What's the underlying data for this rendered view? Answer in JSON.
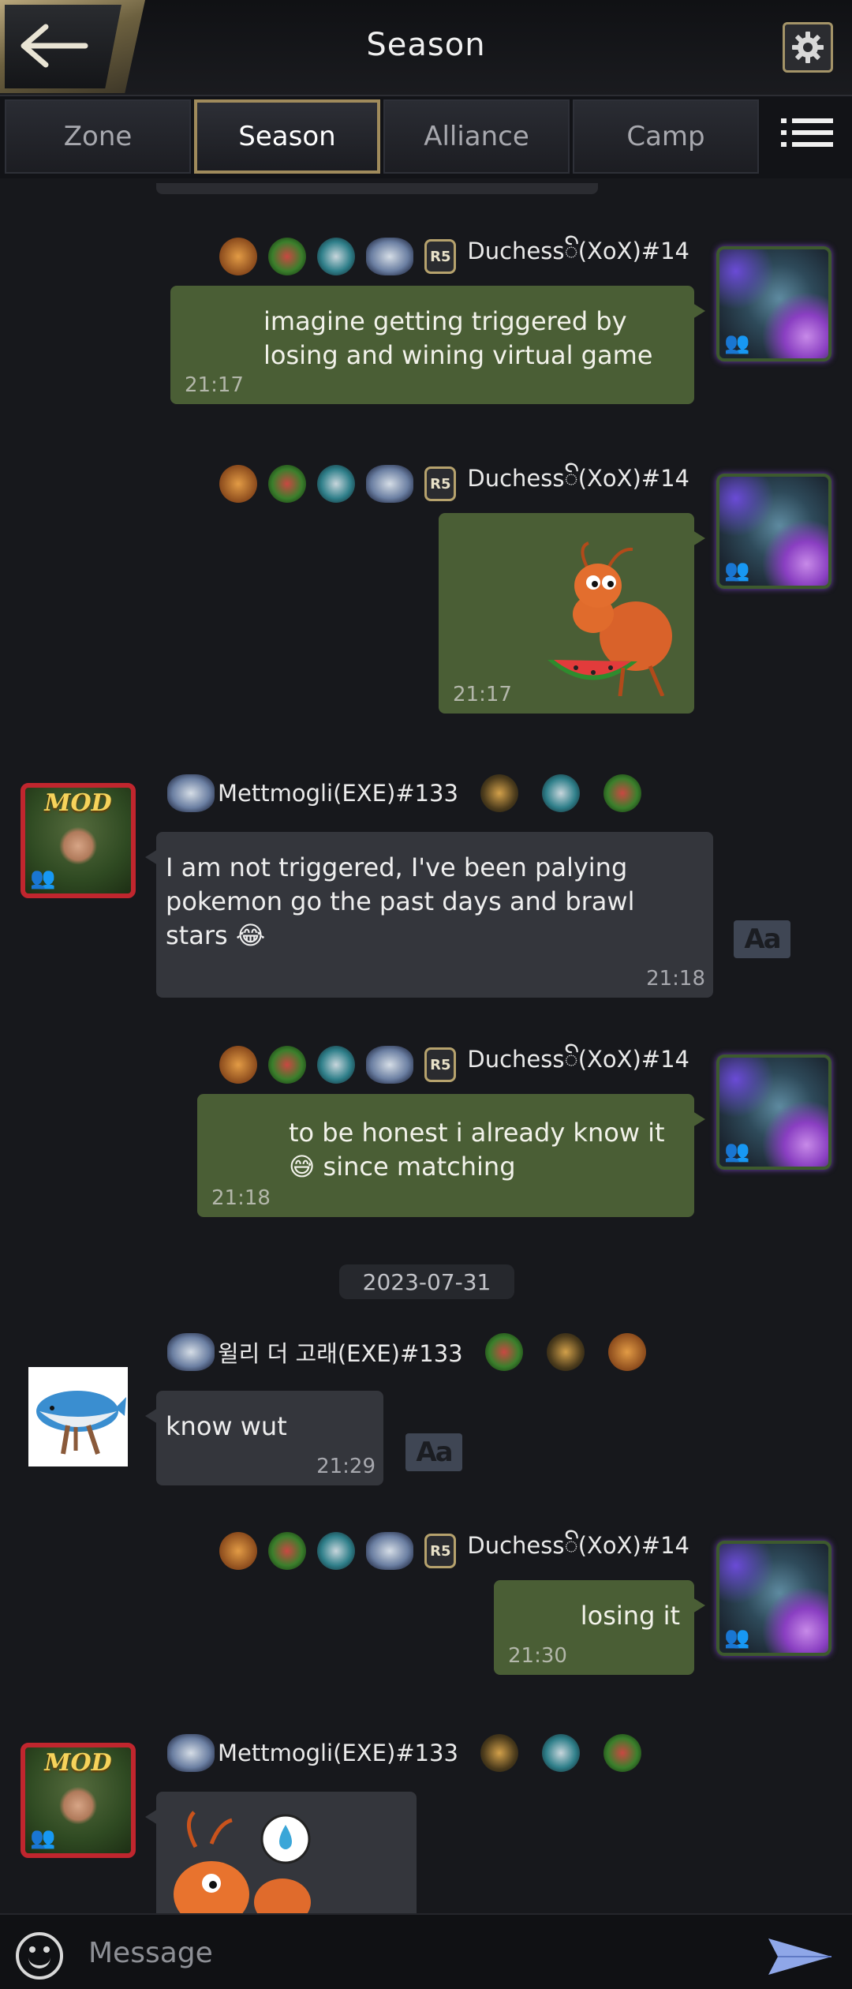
{
  "header": {
    "title": "Season"
  },
  "tabs": [
    {
      "label": "Zone",
      "active": false
    },
    {
      "label": "Season",
      "active": true
    },
    {
      "label": "Alliance",
      "active": false
    },
    {
      "label": "Camp",
      "active": false
    }
  ],
  "icons": {
    "back": "back-arrow-icon",
    "settings": "gear-icon",
    "menu": "list-menu-icon",
    "emoji": "smiley-icon",
    "send": "send-arrow-icon",
    "translate": "translate-icon"
  },
  "colors": {
    "own_bubble": "#4a5e35",
    "other_bubble": "#34363c",
    "accent_gold": "#a08b5c",
    "mod_frame": "#c0262e"
  },
  "messages": [
    {
      "sender": "Duchessꦼ(XoX)#14",
      "rank": "R5",
      "text": "imagine getting triggered by losing and wining virtual game",
      "time": "21:17"
    },
    {
      "sender": "Duchessꦼ(XoX)#14",
      "rank": "R5",
      "sticker": "ant-eating-watermelon-sticker",
      "time": "21:17"
    },
    {
      "sender": "Mettmogli(EXE)#133",
      "avatar_tag": "MOD",
      "text": "I am not triggered, I've been palying pokemon go the past days and brawl stars 😂",
      "time": "21:18",
      "translate": "Aa"
    },
    {
      "sender": "Duchessꦼ(XoX)#14",
      "rank": "R5",
      "text": "to be honest i already know it 😅 since matching",
      "time": "21:18"
    },
    {
      "date": "2023-07-31"
    },
    {
      "sender": "윌리 더 고래(EXE)#133",
      "text": "know wut",
      "time": "21:29",
      "translate": "Aa"
    },
    {
      "sender": "Duchessꦼ(XoX)#14",
      "rank": "R5",
      "text": "losing it",
      "time": "21:30"
    },
    {
      "sender": "Mettmogli(EXE)#133",
      "avatar_tag": "MOD",
      "sticker": "ant-sweating-sticker"
    }
  ],
  "input": {
    "placeholder": "Message"
  }
}
